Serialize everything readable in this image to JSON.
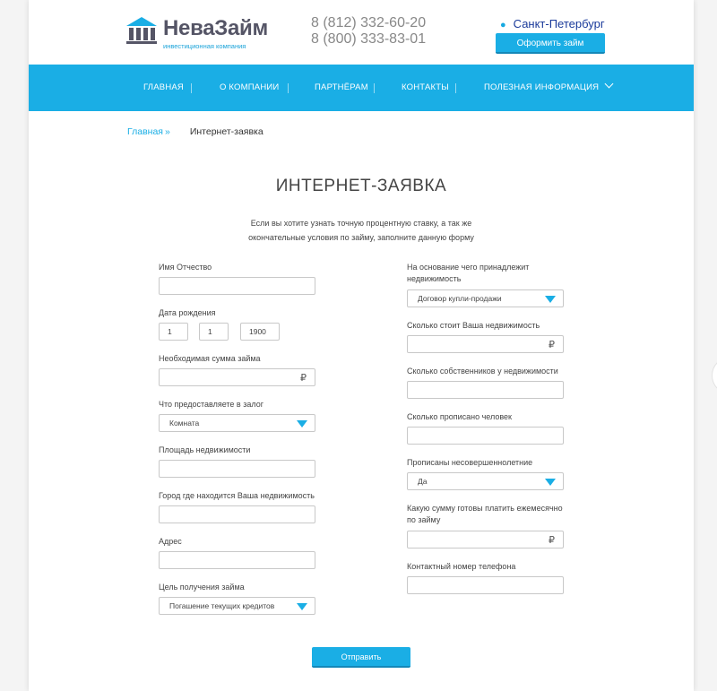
{
  "header": {
    "logo_name": "НеваЗайм",
    "logo_sub": "инвестиционная компания",
    "phone1": "8 (812) 332-60-20",
    "phone2": "8 (800) 333-83-01",
    "city": "Санкт-Петербург",
    "loan_button": "Оформить займ"
  },
  "nav": {
    "items": [
      "Главная",
      "О компании",
      "Партнёрам",
      "Контакты",
      "Полезная информация"
    ]
  },
  "breadcrumb": {
    "home": "Главная",
    "sep": "»",
    "current": "Интернет-заявка"
  },
  "page": {
    "title": "ИНТЕРНЕТ-ЗАЯВКА",
    "intro_line1": "Если вы хотите узнать точную процентную ставку, а так же",
    "intro_line2": "окончательные условия по займу, заполните данную форму"
  },
  "form": {
    "left": {
      "name_label": "Имя Отчество",
      "dob_label": "Дата рождения",
      "dob_day": "1",
      "dob_month": "1",
      "dob_year": "1900",
      "amount_label": "Необходимая сумма займа",
      "collateral_label": "Что предоставляете в залог",
      "collateral_value": "Комната",
      "area_label": "Площадь недвижимости",
      "city_label": "Город где находится Ваша недвижимость",
      "address_label": "Адрес",
      "purpose_label": "Цель получения займа",
      "purpose_value": "Погашение текущих кредитов"
    },
    "right": {
      "ownership_label_1": "На основание чего принадлежит",
      "ownership_label_2": "недвижимость",
      "ownership_value": "Договор купли-продажи",
      "price_label": "Сколько стоит Ваша недвижимость",
      "owners_label": "Сколько собственников у недвижимости",
      "registered_label": "Сколько прописано человек",
      "minors_label": "Прописаны несовершеннолетние",
      "minors_value": "Да",
      "monthly_label_1": "Какую сумму готовы платить ежемесячно",
      "monthly_label_2": "по займу",
      "phone_label": "Контактный номер телефона"
    },
    "currency": "₽",
    "submit": "Отправить"
  },
  "colors": {
    "accent": "#1aaee5",
    "link_dark": "#1a3a9a"
  }
}
